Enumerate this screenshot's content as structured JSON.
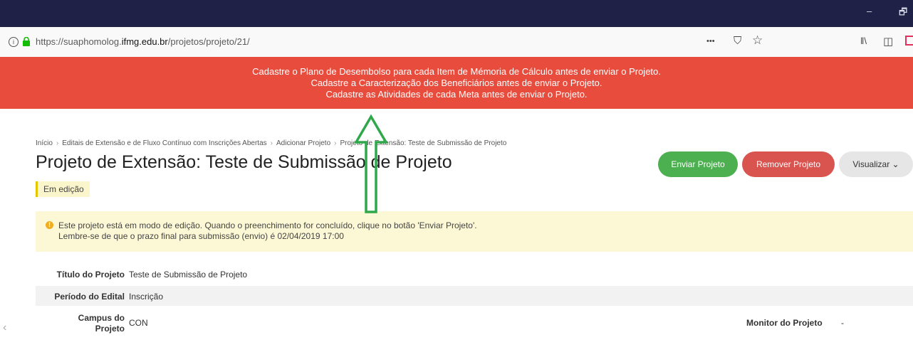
{
  "window": {
    "minimize_glyph": "–",
    "restore_glyph": "🗗"
  },
  "address_bar": {
    "url_prefix": "https://suaphomolog.",
    "url_domain": "ifmg.edu.br",
    "url_path": "/projetos/projeto/21/",
    "more_glyph": "•••",
    "pocket_glyph": "⛉",
    "bookmark_glyph": "☆",
    "library_glyph": "ǁ\\",
    "sidebar_glyph": "◫"
  },
  "alerts": [
    "Cadastre o Plano de Desembolso para cada Item de Mémoria de Cálculo antes de enviar o Projeto.",
    "Cadastre a Caracterização dos Beneficiários antes de enviar o Projeto.",
    "Cadastre as Atividades de cada Meta antes de enviar o Projeto."
  ],
  "breadcrumb": [
    "Início",
    "Editais de Extensão e de Fluxo Contínuo com Inscrições Abertas",
    "Adicionar Projeto",
    "Projeto de Extensão: Teste de Submissão de Projeto"
  ],
  "page": {
    "title": "Projeto de Extensão: Teste de Submissão de Projeto",
    "status": "Em edição"
  },
  "actions": {
    "send": "Enviar Projeto",
    "remove": "Remover Projeto",
    "view": "Visualizar ⌄"
  },
  "notice": {
    "line1": "Este projeto está em modo de edição. Quando o preenchimento for concluído, clique no botão 'Enviar Projeto'.",
    "line2": "Lembre-se de que o prazo final para submissão (envio) é 02/04/2019 17:00"
  },
  "details": [
    {
      "label": "Título do Projeto",
      "value": "Teste de Submissão de Projeto"
    },
    {
      "label": "Período do Edital",
      "value": "Inscrição"
    },
    {
      "label": "Campus do Projeto",
      "value": "CON"
    }
  ],
  "monitor": {
    "label": "Monitor do Projeto",
    "value": "-"
  },
  "colors": {
    "titlebar": "#1f2246",
    "alert": "#e84c3d",
    "send": "#4caf50",
    "remove": "#d9534f",
    "arrow": "#2ea84a"
  }
}
